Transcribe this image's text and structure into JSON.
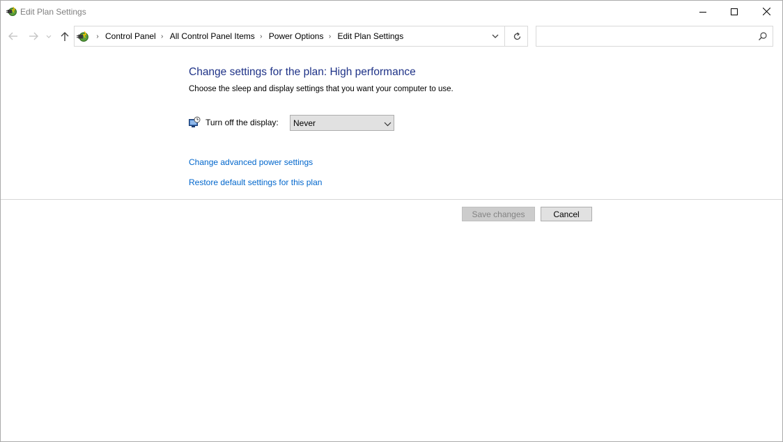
{
  "window": {
    "title": "Edit Plan Settings"
  },
  "address_bar": {
    "breadcrumbs": [
      "Control Panel",
      "All Control Panel Items",
      "Power Options",
      "Edit Plan Settings"
    ]
  },
  "search": {
    "value": "",
    "placeholder": ""
  },
  "main": {
    "heading": "Change settings for the plan: High performance",
    "subtext": "Choose the sleep and display settings that you want your computer to use.",
    "display_setting": {
      "label": "Turn off the display:",
      "selected": "Never"
    },
    "links": {
      "advanced": "Change advanced power settings",
      "restore": "Restore default settings for this plan"
    }
  },
  "buttons": {
    "save": "Save changes",
    "cancel": "Cancel"
  },
  "colors": {
    "heading": "#1e3287",
    "link": "#0066cc",
    "disabled_text": "#838383"
  }
}
